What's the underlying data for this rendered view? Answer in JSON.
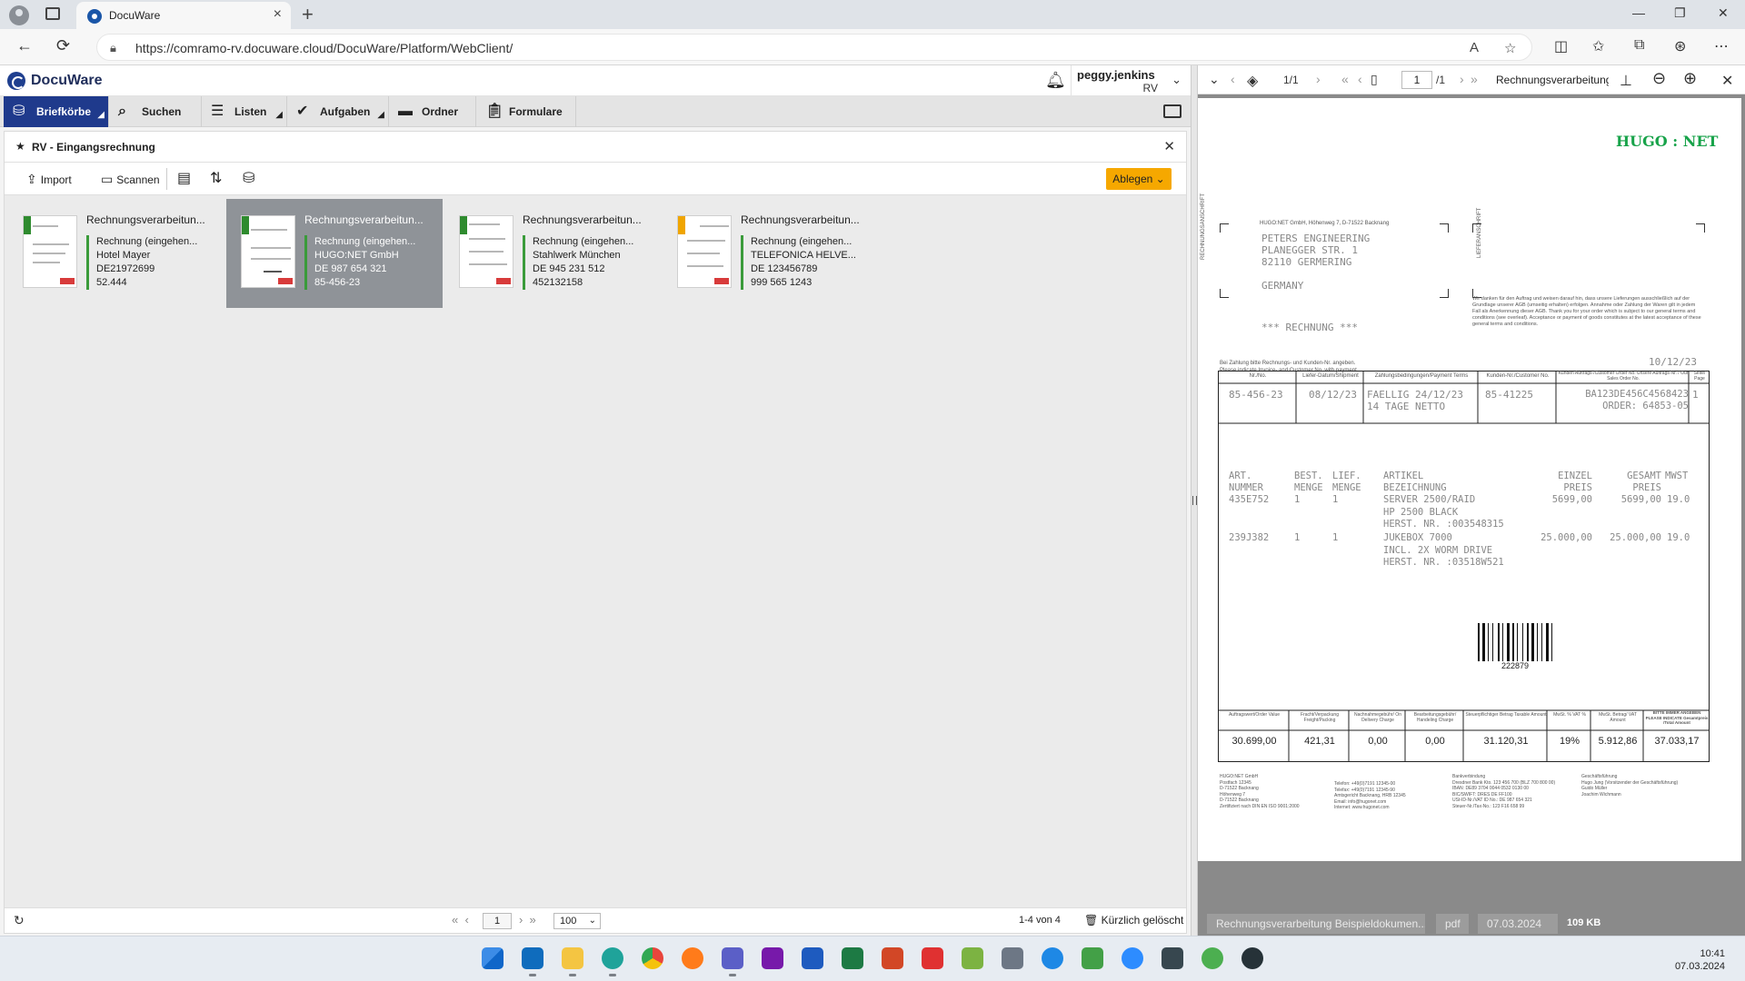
{
  "browser": {
    "tab_title": "DocuWare",
    "url": "https://comramo-rv.docuware.cloud/DocuWare/Platform/WebClient/"
  },
  "app": {
    "logo": "DocuWare",
    "user": {
      "name": "peggy.jenkins",
      "org": "RV"
    }
  },
  "nav": {
    "tabs": [
      {
        "label": "Briefkörbe",
        "icon": "inbox-icon"
      },
      {
        "label": "Suchen",
        "icon": "search-icon"
      },
      {
        "label": "Listen",
        "icon": "list-icon"
      },
      {
        "label": "Aufgaben",
        "icon": "check-icon"
      },
      {
        "label": "Ordner",
        "icon": "folder-icon"
      },
      {
        "label": "Formulare",
        "icon": "clipboard-icon"
      }
    ]
  },
  "panel": {
    "title": "RV - Eingangsrechnung",
    "toolbar": {
      "import": "Import",
      "scan": "Scannen",
      "store": "Ablegen"
    }
  },
  "documents": [
    {
      "title": "Rechnungsverarbeitun...",
      "type": "Rechnung (eingehen...",
      "company": "Hotel Mayer",
      "vat_id": "DE21972699",
      "number": "52.444",
      "flag_color": "#2e8b2e",
      "selected": false
    },
    {
      "title": "Rechnungsverarbeitun...",
      "type": "Rechnung (eingehen...",
      "company": "HUGO:NET GmbH",
      "vat_id": "DE 987 654 321",
      "number": "85-456-23",
      "flag_color": "#2e8b2e",
      "selected": true
    },
    {
      "title": "Rechnungsverarbeitun...",
      "type": "Rechnung (eingehen...",
      "company": "Stahlwerk München",
      "vat_id": "DE 945 231 512",
      "number": "452132158",
      "flag_color": "#2e8b2e",
      "selected": false
    },
    {
      "title": "Rechnungsverarbeitun...",
      "type": "Rechnung (eingehen...",
      "company": "TELEFONICA HELVE...",
      "vat_id": "DE 123456789",
      "number": "999 565 1243",
      "flag_color": "#f0a500",
      "selected": false
    }
  ],
  "status": {
    "page": "1",
    "page_size": "100",
    "count": "1-4 von 4",
    "recently_deleted": "Kürzlich gelöscht"
  },
  "viewer": {
    "layer_pages": "1/1",
    "page": "1",
    "total": "/1",
    "title": "Rechnungsverarbeitung",
    "footer": {
      "doc_name": "Rechnungsverarbeitung Beispieldokumen...",
      "ext": "pdf",
      "date": "07.03.2024",
      "size": "109 KB"
    }
  },
  "invoice": {
    "brand": "HUGO : NET",
    "sender_line": "HUGO:NET GmbH, Höhenweg 7, D-71522 Backnang",
    "address_label_left": "RECHNUNGSANSCHRIFT",
    "address_label_right": "LIEFERANSCHRIFT",
    "address": [
      "PETERS ENGINEERING",
      "PLANEGGER STR. 1",
      "82110 GERMERING",
      "",
      "GERMANY"
    ],
    "doc_kind": "*** RECHNUNG ***",
    "terms_note": "Wir danken für den Auftrag und weisen darauf hin, dass unsere Lieferungen ausschließlich auf der Grundlage unserer AGB (umseitig erhalten) erfolgen. Annahme oder Zahlung der Waren gilt in jedem Fall als Anerkennung dieser AGB. Thank you for your order which is subject to our general terms and conditions (see overleaf). Acceptance or payment of goods constitutes at the latest acceptance of these general terms and conditions.",
    "payment_note": [
      "Bei Zahlung bitte Rechnungs- und Kunden-Nr. angeben.",
      "Please indicate Invoice- and Customer No. with payment."
    ],
    "date": "10/12/23",
    "header_cols": [
      "Nr./No.",
      "Liefer-Datum/Shipment",
      "Zahlungsbedingungen/Payment Terms",
      "Kunden-Nr./Customer No.",
      "Kunden Auftrags-/Customer Order No. Unsere Auftrags-Nr. / Our Sales Order No.",
      "Seite/ Page"
    ],
    "header_vals": [
      "85-456-23",
      "08/12/23",
      "FAELLIG 24/12/23 14 TAGE NETTO",
      "85-41225",
      "BA123DE456C4568423 ORDER: 64853-05",
      "1"
    ],
    "item_head": [
      "ART. NUMMER",
      "BEST. MENGE",
      "LIEF. MENGE",
      "ARTIKEL BEZEICHNUNG",
      "EINZEL PREIS",
      "GESAMT PREIS",
      "MWST"
    ],
    "items": [
      {
        "art": "435E752",
        "best": "1",
        "lief": "1",
        "desc": [
          "SERVER 2500/RAID",
          "HP 2500 BLACK",
          "HERST. NR. :003548315"
        ],
        "unit": "5699,00",
        "total": "5699,00",
        "vat": "19.0"
      },
      {
        "art": "239J382",
        "best": "1",
        "lief": "1",
        "desc": [
          "JUKEBOX 7000",
          "INCL. 2X WORM DRIVE",
          "HERST. NR. :03518W521"
        ],
        "unit": "25.000,00",
        "total": "25.000,00",
        "vat": "19.0"
      }
    ],
    "barcode": "222879",
    "sum_cols": [
      "Auftragswert/Order Value",
      "Fracht/Verpackung Freight/Packing",
      "Nachnahmegebühr/ On Delivery Charge",
      "Bearbeitungsgebühr/ Handeling Charge",
      "Steuerpflichtiger Betrag Taxable Amount",
      "MwSt. % VAT %",
      "MwSt. Betrag/ VAT Amount",
      "BITTE IMMER ANGEBEN PLEASE INDICATE Gesamtpreis /Total Amount"
    ],
    "sum_vals": [
      "30.699,00",
      "421,31",
      "0,00",
      "0,00",
      "31.120,31",
      "19%",
      "5.912,86",
      "37.033,17"
    ],
    "footer_cols": [
      [
        "HUGO:NET GmbH",
        "Postfach 12345",
        "D-71522 Backnang",
        "Höhenweg 7",
        "D-71522 Backnang",
        "Zertifiziert nach DIN EN ISO 9001:2000"
      ],
      [
        "Telefon: +49(0)7191 12345-00",
        "Telefax: +49(0)7191 12345-90",
        "Amtsgericht Backnang, HRB 12345",
        "Email: info@hugonet.com",
        "Internet: www.hugonet.com"
      ],
      [
        "Bankverbindung",
        "Dresdner Bank Kto. 123 456 700 (BLZ 700 800 00)",
        "IBAN: DE89 3704 0044 0532 0130 00",
        "BIC/SWIFT: DRES DE FF100",
        "USt-ID-Nr./VAT ID No.: DE 987 654 321",
        "Steuer-Nr./Tax-No.: 123 F16 658 99"
      ],
      [
        "Geschäftsführung",
        "Hugo Jung (Vorsitzender der Geschäftsführung)",
        "Guido Müller",
        "Joachim Wichmann"
      ]
    ]
  },
  "taskbar": {
    "time": "10:41",
    "date": "07.03.2024"
  }
}
